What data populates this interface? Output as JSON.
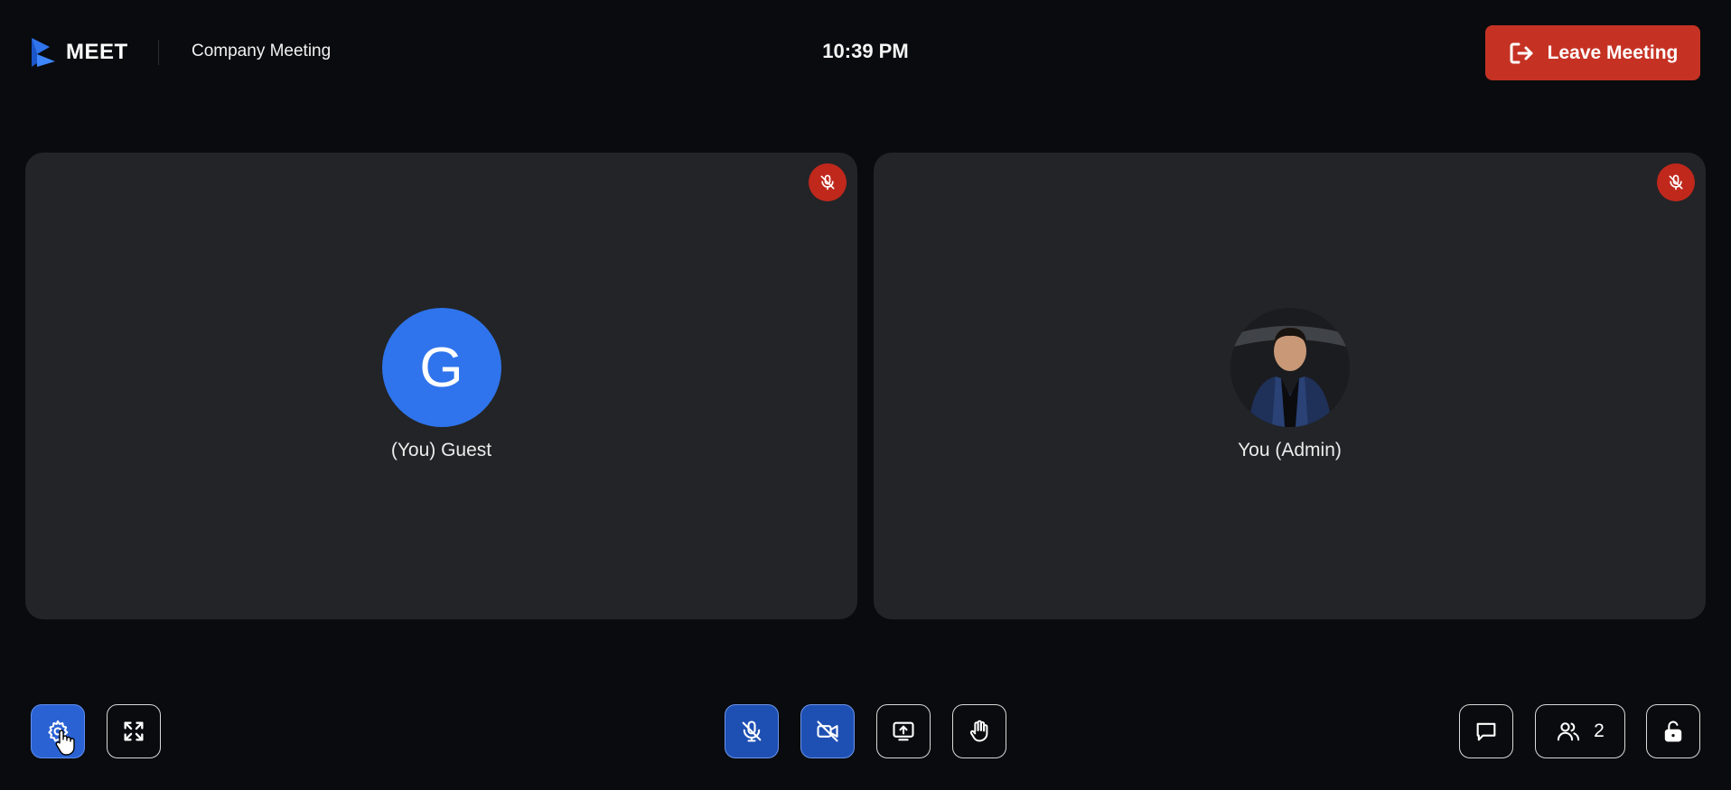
{
  "header": {
    "logo_text": "MEET",
    "meeting_title": "Company Meeting",
    "time": "10:39 PM",
    "leave_label": "Leave Meeting"
  },
  "participants": [
    {
      "name": "(You) Guest",
      "initial": "G",
      "muted": true,
      "avatar_color": "#2f74ec"
    },
    {
      "name": "You (Admin)",
      "initial": "",
      "muted": true,
      "avatar": "photo"
    }
  ],
  "controls": {
    "participant_count": "2"
  },
  "colors": {
    "background": "#0a0b0e",
    "tile": "#232427",
    "accent_blue": "#2f74ec",
    "danger_red": "#c53224"
  },
  "icons": {
    "logo": "meet-logo-icon",
    "leave": "leave-icon",
    "muted_badge": "mic-off-icon",
    "settings": "gear-icon",
    "fullscreen": "fullscreen-icon",
    "mic": "mic-off-icon",
    "camera": "camera-off-icon",
    "share": "screen-share-icon",
    "hand": "raise-hand-icon",
    "chat": "chat-icon",
    "people": "people-icon",
    "lock": "unlock-icon"
  }
}
